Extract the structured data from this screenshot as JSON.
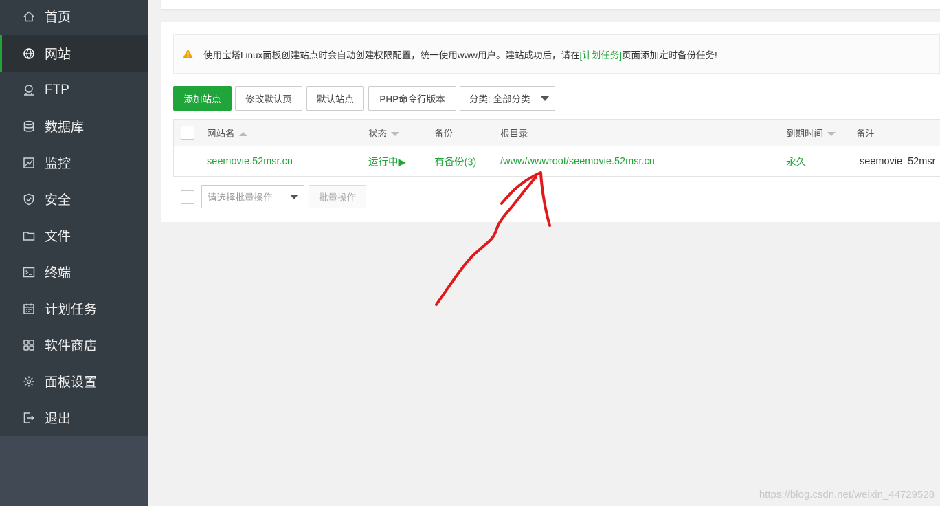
{
  "sidebar": {
    "items": [
      {
        "label": "首页",
        "icon": "home-icon"
      },
      {
        "label": "网站",
        "icon": "globe-icon",
        "active": true
      },
      {
        "label": "FTP",
        "icon": "ftp-icon"
      },
      {
        "label": "数据库",
        "icon": "database-icon"
      },
      {
        "label": "监控",
        "icon": "monitor-icon"
      },
      {
        "label": "安全",
        "icon": "shield-icon"
      },
      {
        "label": "文件",
        "icon": "folder-icon"
      },
      {
        "label": "终端",
        "icon": "terminal-icon"
      },
      {
        "label": "计划任务",
        "icon": "calendar-icon"
      },
      {
        "label": "软件商店",
        "icon": "apps-icon"
      },
      {
        "label": "面板设置",
        "icon": "gear-icon"
      },
      {
        "label": "退出",
        "icon": "logout-icon"
      }
    ]
  },
  "notice": {
    "text_before": "使用宝塔Linux面板创建站点时会自动创建权限配置，统一使用www用户。建站成功后，请在",
    "link": "[计划任务]",
    "text_after": "页面添加定时备份任务!"
  },
  "toolbar": {
    "add_site": "添加站点",
    "edit_default_page": "修改默认页",
    "default_site": "默认站点",
    "php_cli_version": "PHP命令行版本",
    "category": "分类: 全部分类"
  },
  "table": {
    "headers": {
      "name": "网站名",
      "status": "状态",
      "backup": "备份",
      "root": "根目录",
      "expire": "到期时间",
      "remark": "备注"
    },
    "rows": [
      {
        "name": "seemovie.52msr.cn",
        "status": "运行中▶",
        "backup": "有备份(3)",
        "root": "/www/wwwroot/seemovie.52msr.cn",
        "expire": "永久",
        "remark": "seemovie_52msr_"
      }
    ]
  },
  "batch": {
    "select_placeholder": "请选择批量操作",
    "button": "批量操作"
  },
  "watermark": "https://blog.csdn.net/weixin_44729528",
  "colors": {
    "accent": "#20a53a",
    "sidebar": "#353d44",
    "annotation": "#e0191b"
  }
}
